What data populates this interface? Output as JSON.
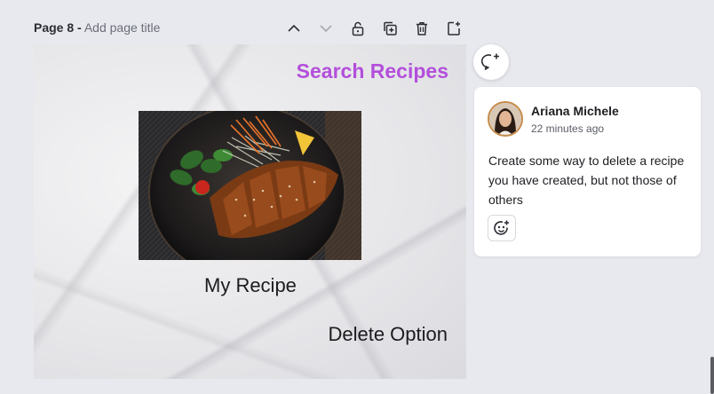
{
  "page_header": {
    "page_number": "Page 8 -",
    "title_placeholder": "Add page title",
    "tools": [
      "chevron-up-icon",
      "chevron-down-icon",
      "lock-icon",
      "duplicate-icon",
      "trash-icon",
      "add-page-icon"
    ]
  },
  "canvas": {
    "heading": "Search Recipes",
    "heading_color": "#b34fdb",
    "my_recipe": "My Recipe",
    "delete_option": "Delete Option"
  },
  "comment": {
    "author": "Ariana Michele",
    "time": "22 minutes ago",
    "text": "Create some way to delete a recipe you have created, but not those of others"
  }
}
